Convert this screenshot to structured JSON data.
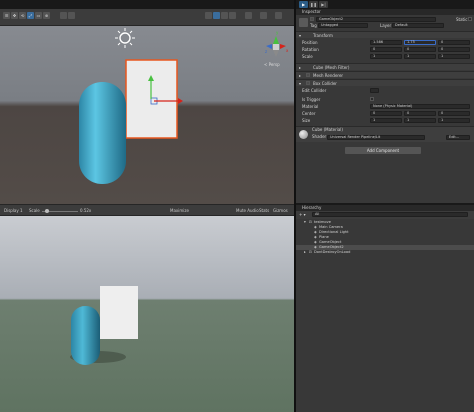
{
  "toolbar": {
    "play": "▶",
    "pause": "❚❚",
    "step": "▶|"
  },
  "scene": {
    "tools": [
      "☰",
      "✥",
      "⟲",
      "⤢",
      "▭",
      "⊕"
    ],
    "axis_labels": {
      "y": "y",
      "x": "x",
      "z": "z"
    },
    "persp_label": "< Persp"
  },
  "game_bar": {
    "display": "Display 1",
    "scale_label": "Scale",
    "scale_value": "0.52x",
    "maximize": "Maximize",
    "mute": "Mute Audio",
    "stats": "Stats",
    "gizmos": "Gizmos"
  },
  "inspector": {
    "tab": "Inspector",
    "object_name": "GameObject2",
    "static_label": "Static",
    "tag_label": "Tag",
    "tag_value": "Untagged",
    "layer_label": "Layer",
    "layer_value": "Default",
    "transform": {
      "title": "Transform",
      "position_label": "Position",
      "rotation_label": "Rotation",
      "scale_label": "Scale",
      "position": {
        "x": "1.586",
        "y": "1.75",
        "z": "0"
      },
      "rotation": {
        "x": "0",
        "y": "0",
        "z": "0"
      },
      "scale": {
        "x": "1",
        "y": "1",
        "z": "1"
      }
    },
    "mesh_filter": {
      "title": "Cube (Mesh Filter)",
      "mesh": "Cube"
    },
    "mesh_renderer": {
      "title": "Mesh Renderer"
    },
    "box_collider": {
      "title": "Box Collider",
      "edit_collider": "Edit Collider",
      "is_trigger": "Is Trigger",
      "material": "Material",
      "material_value": "None (Physic Material)",
      "center": "Center",
      "size": "Size",
      "center_values": {
        "x": "0",
        "y": "0",
        "z": "0"
      },
      "size_values": {
        "x": "1",
        "y": "1",
        "z": "1"
      }
    },
    "material": {
      "title": "Cube (Material)",
      "shader_label": "Shader",
      "shader_value": "Universal Render Pipeline/Lit",
      "edit": "Edit..."
    },
    "add_component": "Add Component"
  },
  "hierarchy": {
    "tab": "Hierarchy",
    "create": "+ ▾",
    "search_placeholder": "All",
    "items": [
      {
        "label": "testmove"
      },
      {
        "label": "Main Camera"
      },
      {
        "label": "Directional Light"
      },
      {
        "label": "Plane"
      },
      {
        "label": "GameObject"
      },
      {
        "label": "GameObject2"
      },
      {
        "label": "DontDestroyOnLoad"
      }
    ]
  },
  "colors": {
    "capsule": "#3aa6c6",
    "selection_accent": "#e8561e",
    "gizmo_red": "#d6231a",
    "gizmo_green": "#48c040",
    "gizmo_blue": "#3a6cc8"
  }
}
